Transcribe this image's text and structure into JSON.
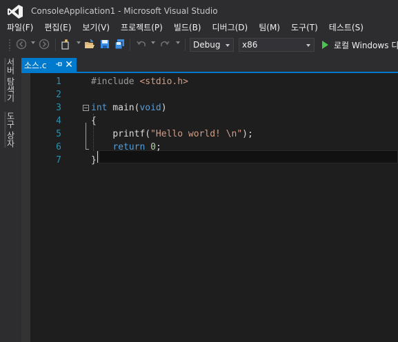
{
  "window": {
    "title": "ConsoleApplication1 - Microsoft Visual Studio"
  },
  "menu": [
    "파일(F)",
    "편집(E)",
    "보기(V)",
    "프로젝트(P)",
    "빌드(B)",
    "디버그(D)",
    "팀(M)",
    "도구(T)",
    "테스트(S)"
  ],
  "toolbar": {
    "config": "Debug",
    "platform": "x86",
    "run_label": "로컬 Windows 디",
    "icons": [
      "back-icon",
      "forward-icon",
      "new-project-icon",
      "open-file-icon",
      "save-icon",
      "save-all-icon",
      "undo-icon",
      "redo-icon",
      "start-icon"
    ]
  },
  "side_tabs": [
    "서버 탐색기",
    "도구 상자"
  ],
  "document": {
    "tab_label": "소스.c",
    "pin_glyph": "⊣",
    "close_glyph": "✕"
  },
  "editor": {
    "line_numbers": [
      "1",
      "2",
      "3",
      "4",
      "5",
      "6",
      "7"
    ],
    "lines": [
      {
        "indent": "",
        "tokens": [
          {
            "t": "pp",
            "v": "#include "
          },
          {
            "t": "inc",
            "v": "<stdio.h>"
          }
        ]
      },
      {
        "indent": "",
        "tokens": []
      },
      {
        "indent": "",
        "tokens": [
          {
            "t": "kw",
            "v": "int"
          },
          {
            "t": "plain",
            "v": " main("
          },
          {
            "t": "kw",
            "v": "void"
          },
          {
            "t": "plain",
            "v": ")"
          }
        ]
      },
      {
        "indent": "",
        "tokens": [
          {
            "t": "plain",
            "v": "{"
          }
        ]
      },
      {
        "indent": "    ",
        "tokens": [
          {
            "t": "plain",
            "v": "printf("
          },
          {
            "t": "str",
            "v": "\"Hello world! \\n\""
          },
          {
            "t": "plain",
            "v": ");"
          }
        ]
      },
      {
        "indent": "    ",
        "tokens": [
          {
            "t": "kw",
            "v": "return"
          },
          {
            "t": "plain",
            "v": " "
          },
          {
            "t": "num",
            "v": "0"
          },
          {
            "t": "plain",
            "v": ";"
          }
        ]
      },
      {
        "indent": "",
        "tokens": [
          {
            "t": "plain",
            "v": "}"
          }
        ]
      }
    ]
  },
  "colors": {
    "accent": "#007acc",
    "editor_bg": "#1e1e1e",
    "chrome_bg": "#2d2d30",
    "line_number": "#2b91af",
    "keyword": "#569cd6",
    "string": "#d69d85",
    "run_green": "#4ec24e",
    "logo_purple": "#68217a"
  }
}
